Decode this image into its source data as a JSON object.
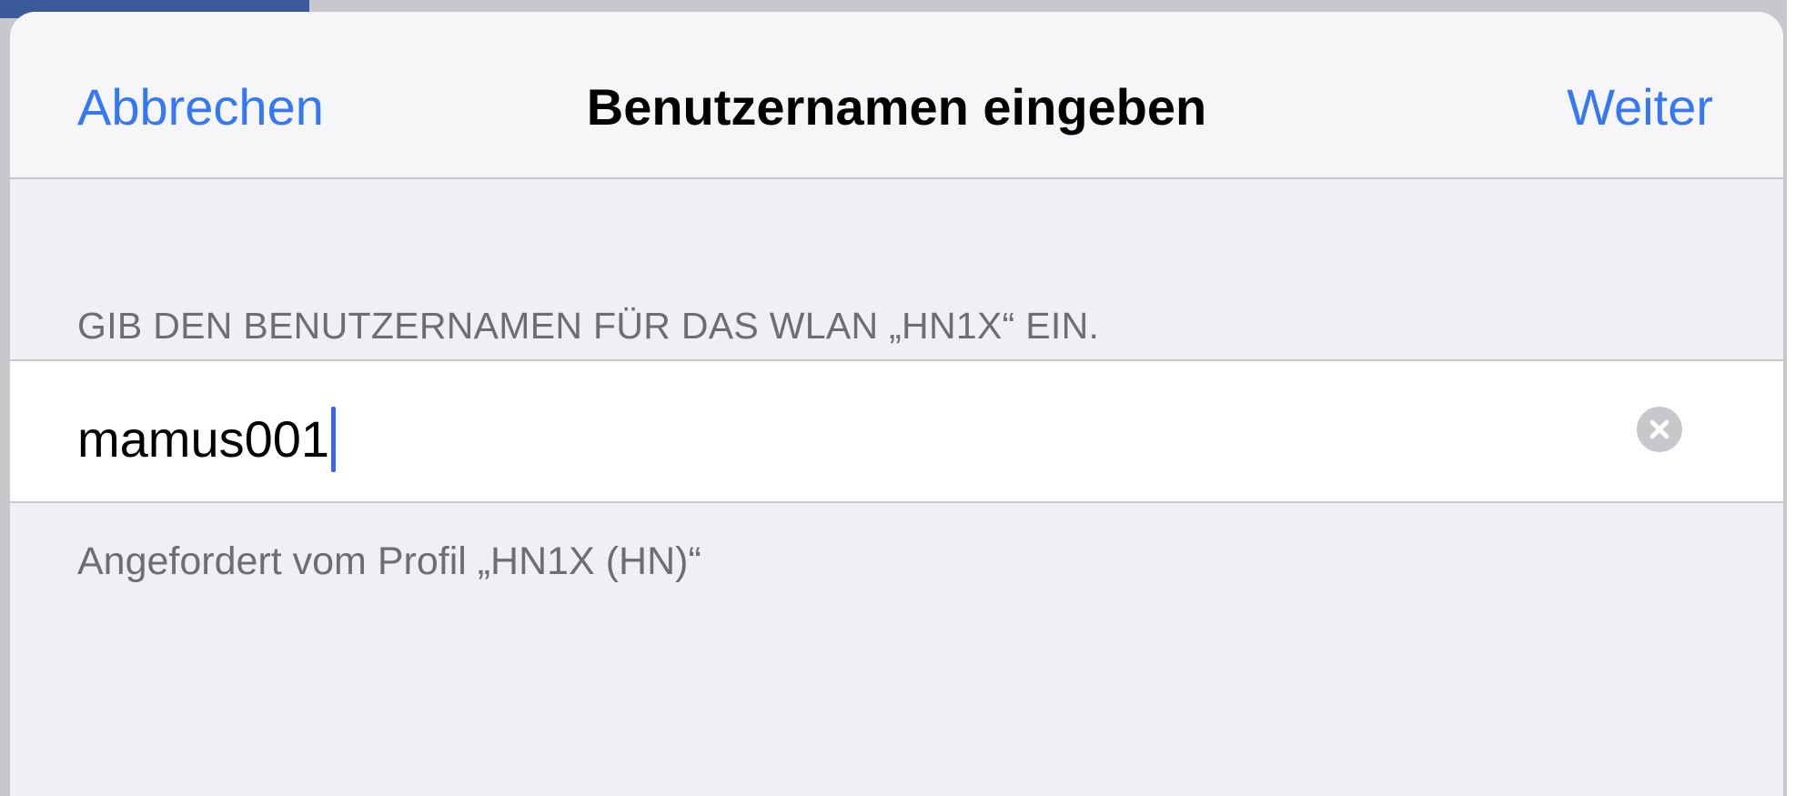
{
  "navbar": {
    "cancel_label": "Abbrechen",
    "title": "Benutzernamen eingeben",
    "next_label": "Weiter"
  },
  "section": {
    "header": "GIB DEN BENUTZERNAMEN FÜR DAS WLAN „HN1X“ EIN."
  },
  "username_field": {
    "value": "mamus001",
    "clear_icon": "clear-circle-icon"
  },
  "footer": {
    "note": "Angefordert vom Profil „HN1X (HN)“"
  },
  "colors": {
    "accent": "#3478f6",
    "caret": "#3a63f0",
    "background": "#efeff4",
    "secondary_text": "#6d6d72"
  }
}
